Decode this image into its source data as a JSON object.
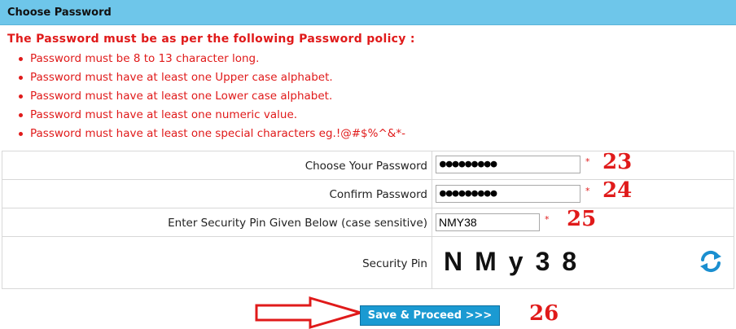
{
  "header": {
    "title": "Choose Password"
  },
  "policy": {
    "heading": "The Password must be as per the following Password policy :",
    "items": [
      "Password must be 8 to 13 character long.",
      "Password must have at least one Upper case alphabet.",
      "Password must have at least one Lower case alphabet.",
      "Password must have at least one numeric value.",
      "Password must have at least one special characters eg.!@#$%^&*-"
    ]
  },
  "form": {
    "password": {
      "label": "Choose Your Password",
      "value": "●●●●●●●●●",
      "required": "*",
      "step": "23"
    },
    "confirm": {
      "label": "Confirm Password",
      "value": "●●●●●●●●●",
      "required": "*",
      "step": "24"
    },
    "pin_input": {
      "label": "Enter Security Pin Given Below (case sensitive)",
      "value": "NMY38",
      "required": "*",
      "step": "25"
    },
    "security_pin": {
      "label": "Security Pin",
      "captcha_text": "NMy38"
    }
  },
  "actions": {
    "save_label": "Save & Proceed >>>",
    "step": "26"
  },
  "colors": {
    "header_bg": "#6ec6ea",
    "policy_text": "#e01a1a",
    "button_bg": "#1b9ad2",
    "refresh_icon": "#1b8fd0"
  },
  "icons": {
    "refresh": "refresh-icon",
    "arrow": "right-arrow-icon"
  }
}
